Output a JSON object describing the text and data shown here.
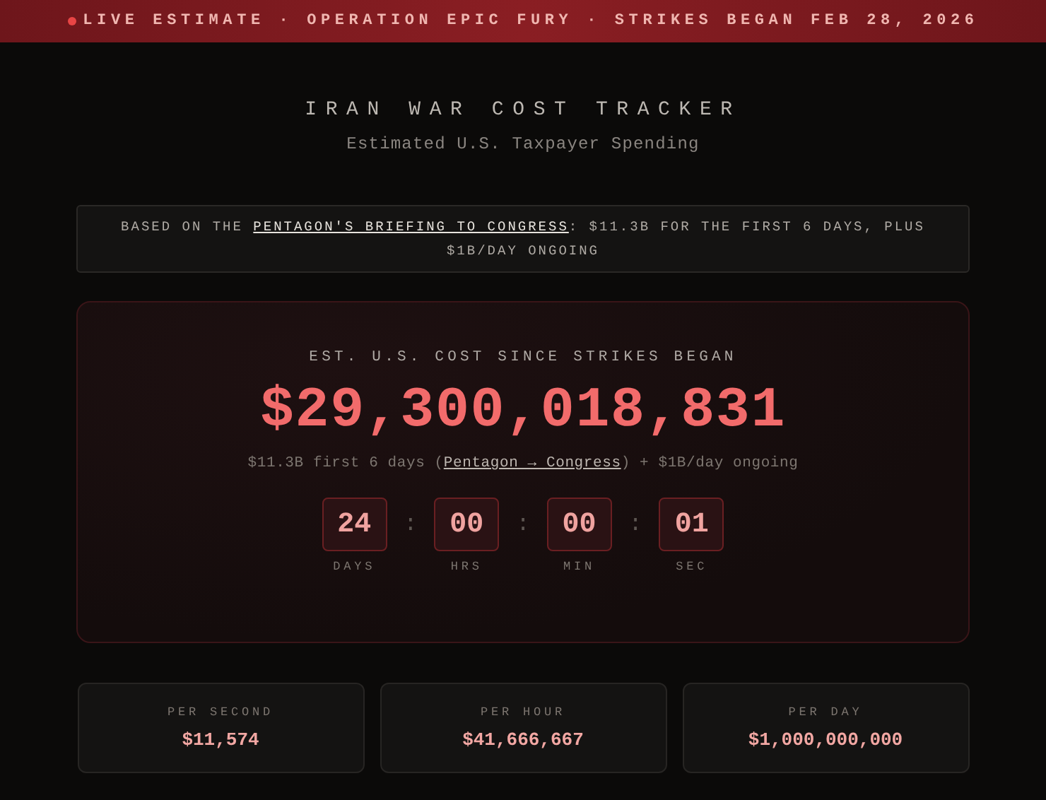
{
  "banner": {
    "text": "LIVE ESTIMATE · OPERATION EPIC FURY · STRIKES BEGAN FEB 28, 2026",
    "live": true
  },
  "header": {
    "title": "IRAN WAR COST TRACKER",
    "subtitle": "Estimated U.S. Taxpayer Spending"
  },
  "notice": {
    "prefix": "BASED ON THE ",
    "link": "PENTAGON'S BRIEFING TO CONGRESS",
    "suffix": ": $11.3B FOR THE FIRST 6 DAYS, PLUS $1B/DAY ONGOING"
  },
  "cost": {
    "label": "EST. U.S. COST SINCE STRIKES BEGAN",
    "amount": "$29,300,018,831",
    "note_prefix": "$11.3B first 6 days (",
    "note_link": "Pentagon → Congress",
    "note_suffix": ") + $1B/day ongoing",
    "timer": [
      {
        "value": "24",
        "label": "DAYS"
      },
      {
        "value": "00",
        "label": "HRS"
      },
      {
        "value": "00",
        "label": "MIN"
      },
      {
        "value": "01",
        "label": "SEC"
      }
    ],
    "separator": ":"
  },
  "stats": [
    {
      "label": "PER SECOND",
      "value": "$11,574"
    },
    {
      "label": "PER HOUR",
      "value": "$41,666,667"
    },
    {
      "label": "PER DAY",
      "value": "$1,000,000,000"
    }
  ]
}
